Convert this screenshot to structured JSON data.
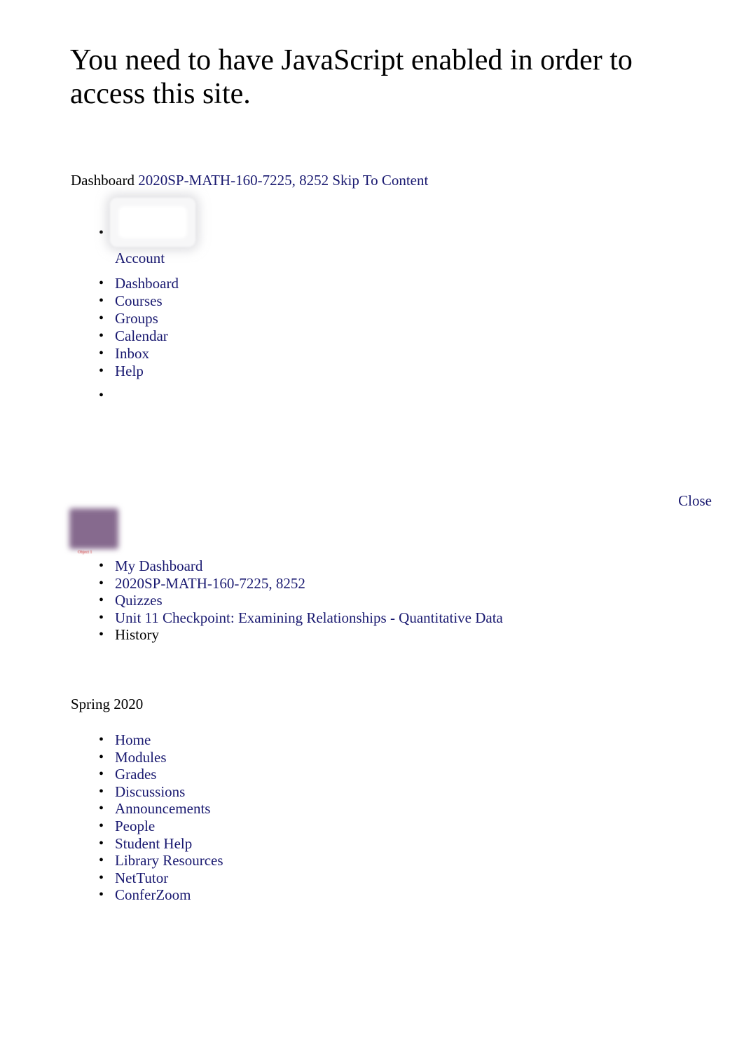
{
  "notice": {
    "javascript_warning": "You need to have JavaScript enabled in order to access this site."
  },
  "top_nav": {
    "dashboard_label": "Dashboard",
    "course_link": "2020SP-MATH-160-7225, 8252",
    "skip_link": "Skip To Content"
  },
  "global_nav": {
    "avatar_icon": "user-avatar-image-placeholder",
    "items": [
      {
        "label": "Account",
        "is_link": true
      },
      {
        "label": "Dashboard",
        "is_link": true
      },
      {
        "label": "Courses",
        "is_link": true
      },
      {
        "label": "Groups",
        "is_link": true
      },
      {
        "label": "Calendar",
        "is_link": true
      },
      {
        "label": "Inbox",
        "is_link": true
      },
      {
        "label": "Help",
        "is_link": true
      }
    ],
    "empty_item": ""
  },
  "tray": {
    "close_label": "Close"
  },
  "object": {
    "caption": "Object 1",
    "fill_color": "#866a8e",
    "caption_color": "#cc2222"
  },
  "breadcrumb": {
    "items": [
      {
        "label": "My Dashboard",
        "is_link": true
      },
      {
        "label": "2020SP-MATH-160-7225, 8252",
        "is_link": true
      },
      {
        "label": "Quizzes",
        "is_link": true
      },
      {
        "label": "Unit 11 Checkpoint: Examining Relationships - Quantitative Data",
        "is_link": true
      },
      {
        "label": "History",
        "is_link": false
      }
    ]
  },
  "course": {
    "term_label": "Spring 2020",
    "nav_items": [
      {
        "label": "Home"
      },
      {
        "label": "Modules"
      },
      {
        "label": "Grades"
      },
      {
        "label": "Discussions"
      },
      {
        "label": "Announcements"
      },
      {
        "label": "People"
      },
      {
        "label": "Student Help"
      },
      {
        "label": "Library Resources"
      },
      {
        "label": "NetTutor"
      },
      {
        "label": "ConferZoom"
      }
    ]
  },
  "colors": {
    "link": "#191970",
    "text": "#000000",
    "background": "#ffffff"
  }
}
